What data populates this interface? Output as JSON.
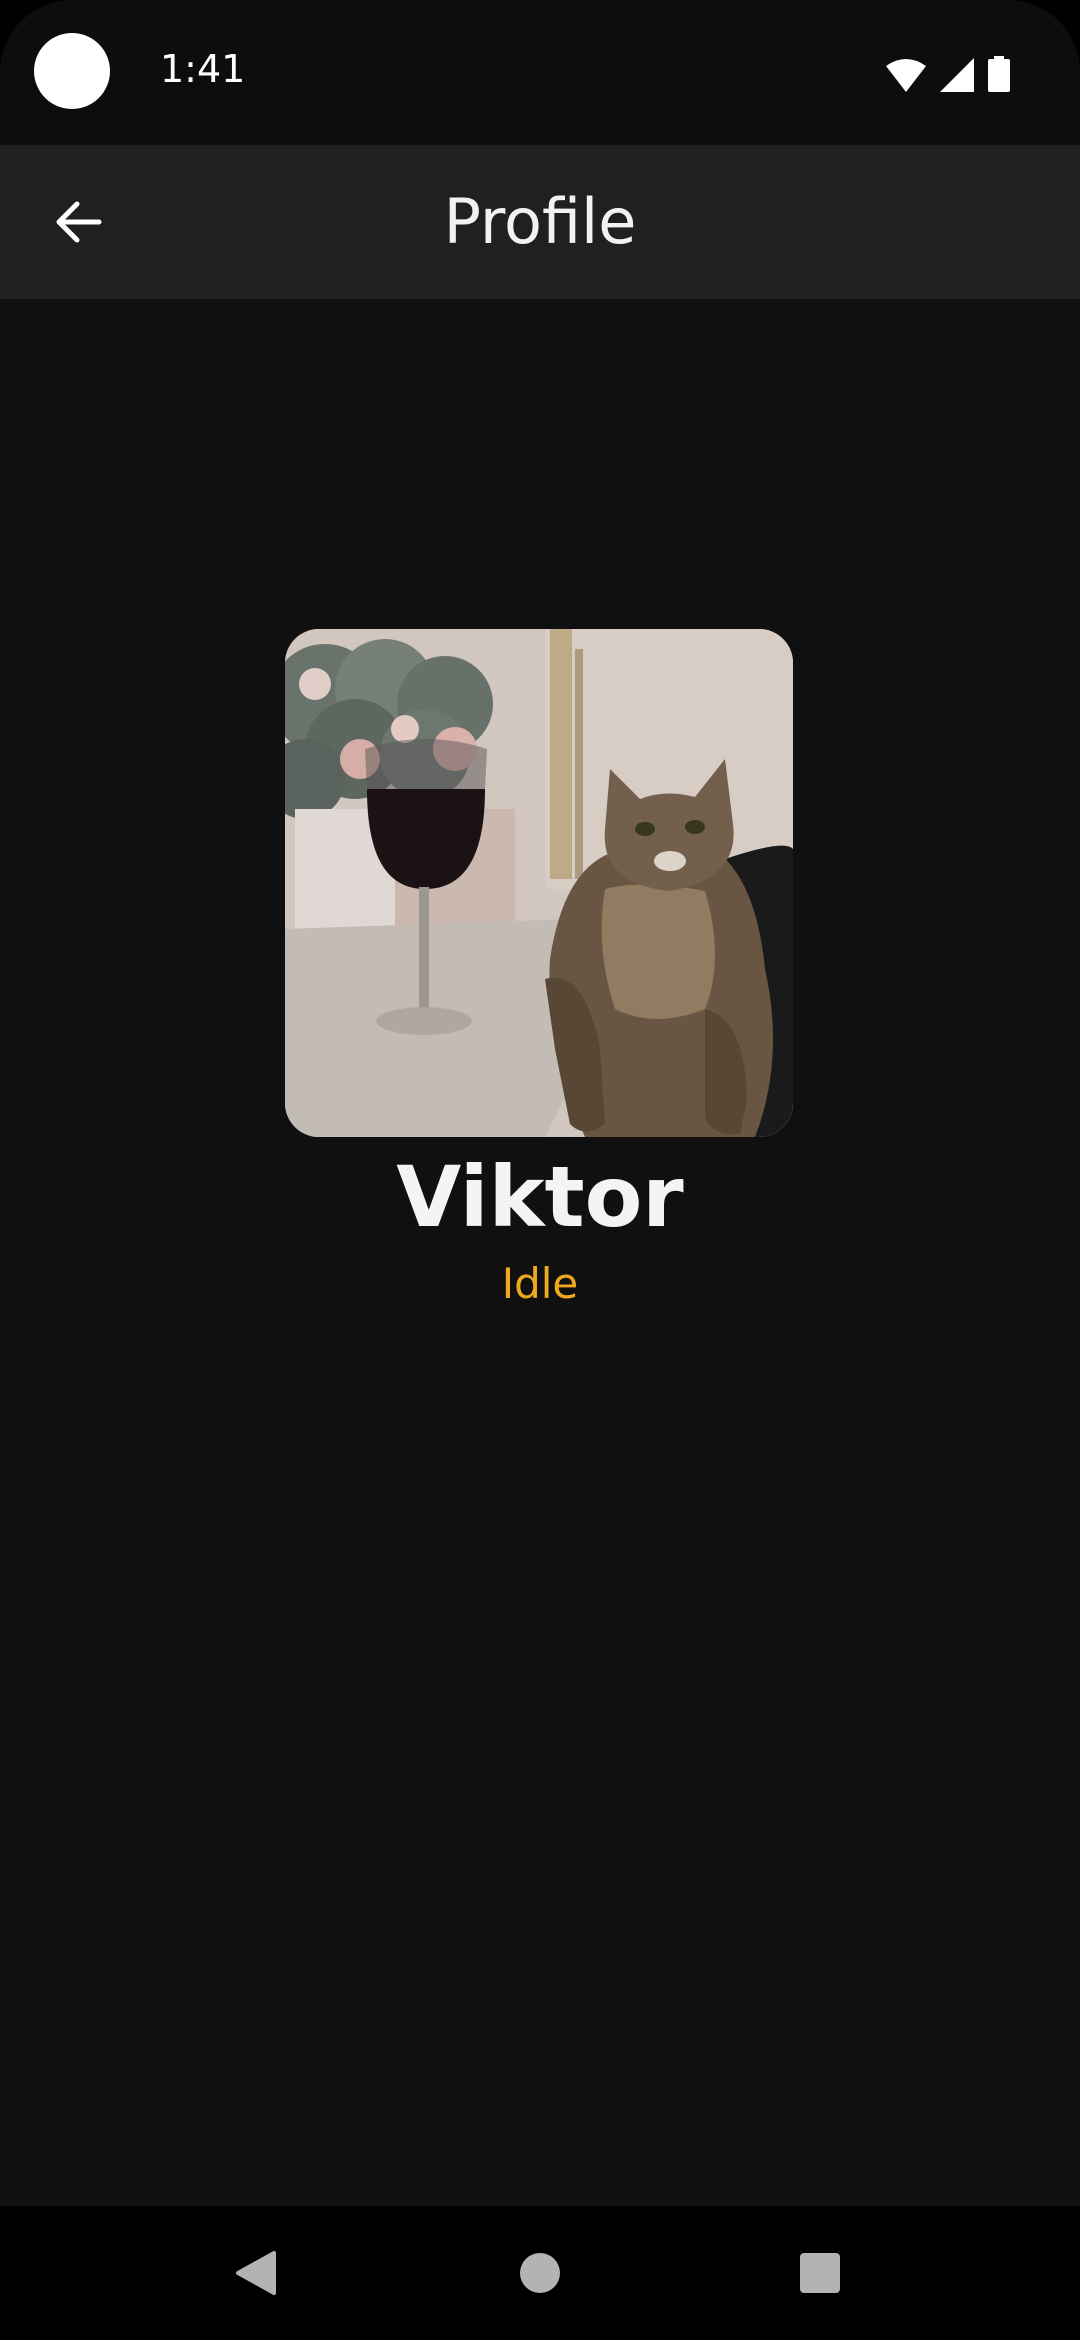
{
  "status_bar": {
    "time": "1:41",
    "icons": [
      "wifi-icon",
      "cellular-signal-icon",
      "battery-icon"
    ]
  },
  "app_bar": {
    "title": "Profile",
    "back_icon": "arrow-back-icon"
  },
  "profile": {
    "name": "Viktor",
    "status": "Idle",
    "status_color": "#f0a81c"
  },
  "nav_bar": {
    "icons": [
      "nav-back-icon",
      "nav-home-icon",
      "nav-recents-icon"
    ]
  },
  "colors": {
    "background": "#101010",
    "app_bar": "#202020",
    "status_bar": "#0d0d0d",
    "text_primary": "#f4f4f4"
  }
}
